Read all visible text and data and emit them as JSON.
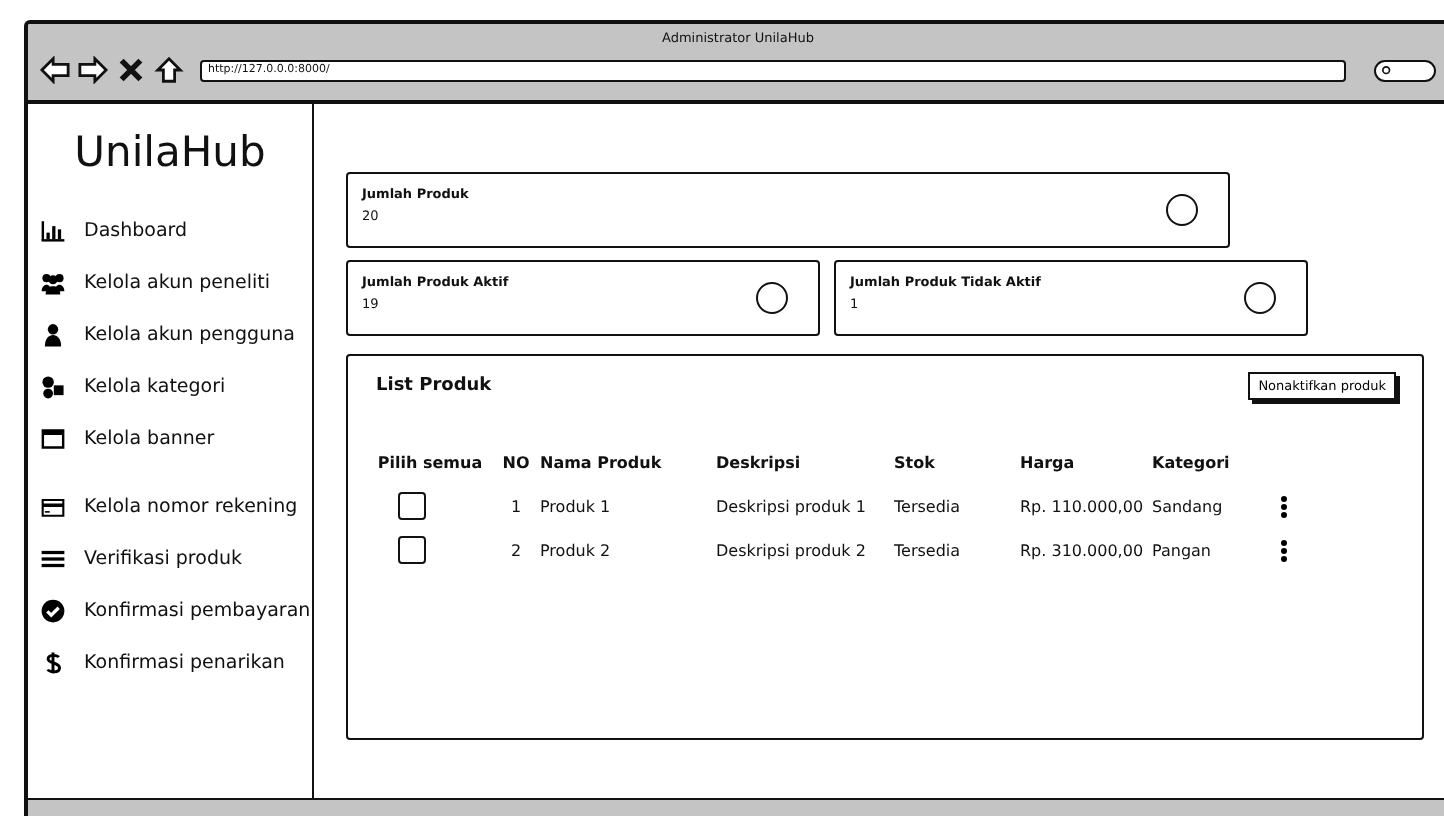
{
  "window": {
    "title": "Administrator UnilaHub",
    "url": "http://127.0.0.0:8000/"
  },
  "sidebar": {
    "brand": "UnilaHub",
    "items": [
      {
        "label": "Dashboard",
        "kind": "chart"
      },
      {
        "label": "Kelola akun peneliti",
        "kind": "users"
      },
      {
        "label": "Kelola akun pengguna",
        "kind": "user"
      },
      {
        "label": "Kelola kategori",
        "kind": "shapes"
      },
      {
        "label": "Kelola banner",
        "kind": "window"
      },
      {
        "label": "Kelola nomor rekening",
        "kind": "card"
      },
      {
        "label": "Verifikasi produk",
        "kind": "list"
      },
      {
        "label": "Konfirmasi pembayaran",
        "kind": "check"
      },
      {
        "label": "Konfirmasi penarikan",
        "kind": "dollar"
      }
    ]
  },
  "stats": [
    {
      "label": "Jumlah Produk",
      "value": "20"
    },
    {
      "label": "Jumlah Produk Aktif",
      "value": "19"
    },
    {
      "label": "Jumlah Produk Tidak Aktif",
      "value": "1"
    }
  ],
  "table": {
    "title": "List Produk",
    "action": "Nonaktifkan produk",
    "select_all_label": "Pilih semua",
    "columns": [
      "NO",
      "Nama Produk",
      "Deskripsi",
      "Stok",
      "Harga",
      "Kategori"
    ],
    "rows": [
      {
        "checked": false,
        "cells": [
          "1",
          "Produk 1",
          "Deskripsi produk 1",
          "Tersedia",
          "Rp. 110.000,00",
          "Sandang"
        ]
      },
      {
        "checked": false,
        "cells": [
          "2",
          "Produk 2",
          "Deskripsi produk 2",
          "Tersedia",
          "Rp. 310.000,00",
          "Pangan"
        ]
      }
    ]
  }
}
